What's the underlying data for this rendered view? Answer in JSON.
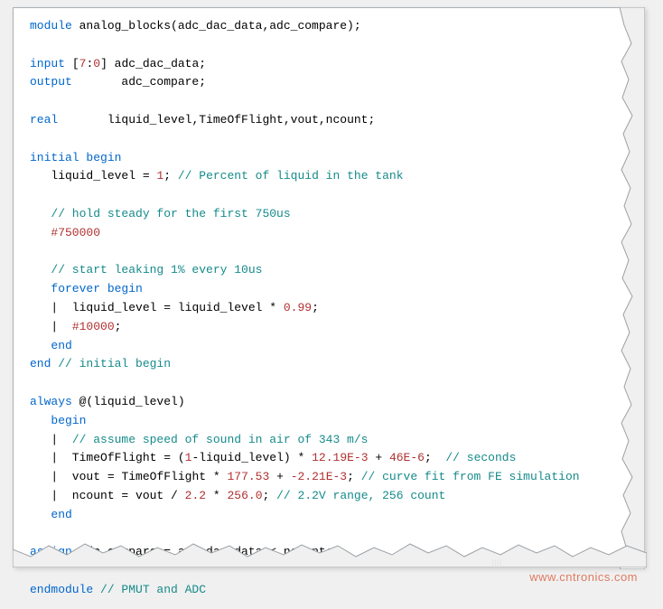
{
  "source_language": "Verilog / SystemVerilog",
  "module_name": "analog_blocks",
  "ports": [
    "adc_dac_data",
    "adc_compare"
  ],
  "code_lines": [
    {
      "segs": [
        {
          "t": "module ",
          "c": "kw"
        },
        {
          "t": "analog_blocks(adc_dac_data,adc_compare);",
          "c": "id"
        }
      ]
    },
    {
      "segs": [
        {
          "t": "",
          "c": "id"
        }
      ]
    },
    {
      "segs": [
        {
          "t": "input ",
          "c": "kw"
        },
        {
          "t": "[",
          "c": "id"
        },
        {
          "t": "7",
          "c": "num"
        },
        {
          "t": ":",
          "c": "id"
        },
        {
          "t": "0",
          "c": "num"
        },
        {
          "t": "] adc_dac_data;",
          "c": "id"
        }
      ]
    },
    {
      "segs": [
        {
          "t": "output       ",
          "c": "kw"
        },
        {
          "t": "adc_compare;",
          "c": "id"
        }
      ]
    },
    {
      "segs": [
        {
          "t": "",
          "c": "id"
        }
      ]
    },
    {
      "segs": [
        {
          "t": "real       ",
          "c": "kw"
        },
        {
          "t": "liquid_level,TimeOfFlight,vout,ncount;",
          "c": "id"
        }
      ]
    },
    {
      "segs": [
        {
          "t": "",
          "c": "id"
        }
      ]
    },
    {
      "segs": [
        {
          "t": "initial begin",
          "c": "kw"
        }
      ]
    },
    {
      "segs": [
        {
          "t": "   liquid_level ",
          "c": "id"
        },
        {
          "t": "= ",
          "c": "op"
        },
        {
          "t": "1",
          "c": "num"
        },
        {
          "t": "; ",
          "c": "id"
        },
        {
          "t": "// Percent of liquid in the tank",
          "c": "cmt"
        }
      ]
    },
    {
      "segs": [
        {
          "t": "",
          "c": "id"
        }
      ]
    },
    {
      "segs": [
        {
          "t": "   ",
          "c": "id"
        },
        {
          "t": "// hold steady for the first 750us",
          "c": "cmt"
        }
      ]
    },
    {
      "segs": [
        {
          "t": "   ",
          "c": "id"
        },
        {
          "t": "#750000",
          "c": "num"
        }
      ]
    },
    {
      "segs": [
        {
          "t": "",
          "c": "id"
        }
      ]
    },
    {
      "segs": [
        {
          "t": "   ",
          "c": "id"
        },
        {
          "t": "// start leaking 1% every 10us",
          "c": "cmt"
        }
      ]
    },
    {
      "segs": [
        {
          "t": "   ",
          "c": "id"
        },
        {
          "t": "forever begin",
          "c": "kw"
        }
      ]
    },
    {
      "segs": [
        {
          "t": "   |  liquid_level ",
          "c": "id"
        },
        {
          "t": "= ",
          "c": "op"
        },
        {
          "t": "liquid_level ",
          "c": "id"
        },
        {
          "t": "* ",
          "c": "op"
        },
        {
          "t": "0.99",
          "c": "num"
        },
        {
          "t": ";",
          "c": "id"
        }
      ]
    },
    {
      "segs": [
        {
          "t": "   |  ",
          "c": "id"
        },
        {
          "t": "#10000",
          "c": "num"
        },
        {
          "t": ";",
          "c": "id"
        }
      ]
    },
    {
      "segs": [
        {
          "t": "   ",
          "c": "id"
        },
        {
          "t": "end",
          "c": "kw"
        }
      ]
    },
    {
      "segs": [
        {
          "t": "end ",
          "c": "kw"
        },
        {
          "t": "// initial begin",
          "c": "cmt"
        }
      ]
    },
    {
      "segs": [
        {
          "t": "",
          "c": "id"
        }
      ]
    },
    {
      "segs": [
        {
          "t": "always ",
          "c": "kw"
        },
        {
          "t": "@",
          "c": "op"
        },
        {
          "t": "(liquid_level)",
          "c": "id"
        }
      ]
    },
    {
      "segs": [
        {
          "t": "   ",
          "c": "id"
        },
        {
          "t": "begin",
          "c": "kw"
        }
      ]
    },
    {
      "segs": [
        {
          "t": "   |  ",
          "c": "id"
        },
        {
          "t": "// assume speed of sound in air of 343 m/s",
          "c": "cmt"
        }
      ]
    },
    {
      "segs": [
        {
          "t": "   |  TimeOfFlight ",
          "c": "id"
        },
        {
          "t": "= ",
          "c": "op"
        },
        {
          "t": "(",
          "c": "id"
        },
        {
          "t": "1",
          "c": "num"
        },
        {
          "t": "-liquid_level) ",
          "c": "id"
        },
        {
          "t": "* ",
          "c": "op"
        },
        {
          "t": "12.19E-3 ",
          "c": "num"
        },
        {
          "t": "+ ",
          "c": "op"
        },
        {
          "t": "46E-6",
          "c": "num"
        },
        {
          "t": ";  ",
          "c": "id"
        },
        {
          "t": "// seconds",
          "c": "cmt"
        }
      ]
    },
    {
      "segs": [
        {
          "t": "   |  vout ",
          "c": "id"
        },
        {
          "t": "= ",
          "c": "op"
        },
        {
          "t": "TimeOfFlight ",
          "c": "id"
        },
        {
          "t": "* ",
          "c": "op"
        },
        {
          "t": "177.53 ",
          "c": "num"
        },
        {
          "t": "+ ",
          "c": "op"
        },
        {
          "t": "-2.21E-3",
          "c": "num"
        },
        {
          "t": "; ",
          "c": "id"
        },
        {
          "t": "// curve fit from FE simulation",
          "c": "cmt"
        }
      ]
    },
    {
      "segs": [
        {
          "t": "   |  ncount ",
          "c": "id"
        },
        {
          "t": "= ",
          "c": "op"
        },
        {
          "t": "vout ",
          "c": "id"
        },
        {
          "t": "/ ",
          "c": "op"
        },
        {
          "t": "2.2 ",
          "c": "num"
        },
        {
          "t": "* ",
          "c": "op"
        },
        {
          "t": "256.0",
          "c": "num"
        },
        {
          "t": "; ",
          "c": "id"
        },
        {
          "t": "// 2.2V range, 256 count",
          "c": "cmt"
        }
      ]
    },
    {
      "segs": [
        {
          "t": "   ",
          "c": "id"
        },
        {
          "t": "end",
          "c": "kw"
        }
      ]
    },
    {
      "segs": [
        {
          "t": "",
          "c": "id"
        }
      ]
    },
    {
      "segs": [
        {
          "t": "assign ",
          "c": "kw"
        },
        {
          "t": "adc_compare ",
          "c": "id"
        },
        {
          "t": "= ",
          "c": "op"
        },
        {
          "t": "adc_dac_data < ncount;",
          "c": "id"
        }
      ]
    },
    {
      "segs": [
        {
          "t": "",
          "c": "id"
        }
      ]
    },
    {
      "segs": [
        {
          "t": "endmodule ",
          "c": "kw"
        },
        {
          "t": "// PMUT and ADC",
          "c": "cmt"
        }
      ]
    }
  ],
  "watermark": "www.cntronics.com"
}
